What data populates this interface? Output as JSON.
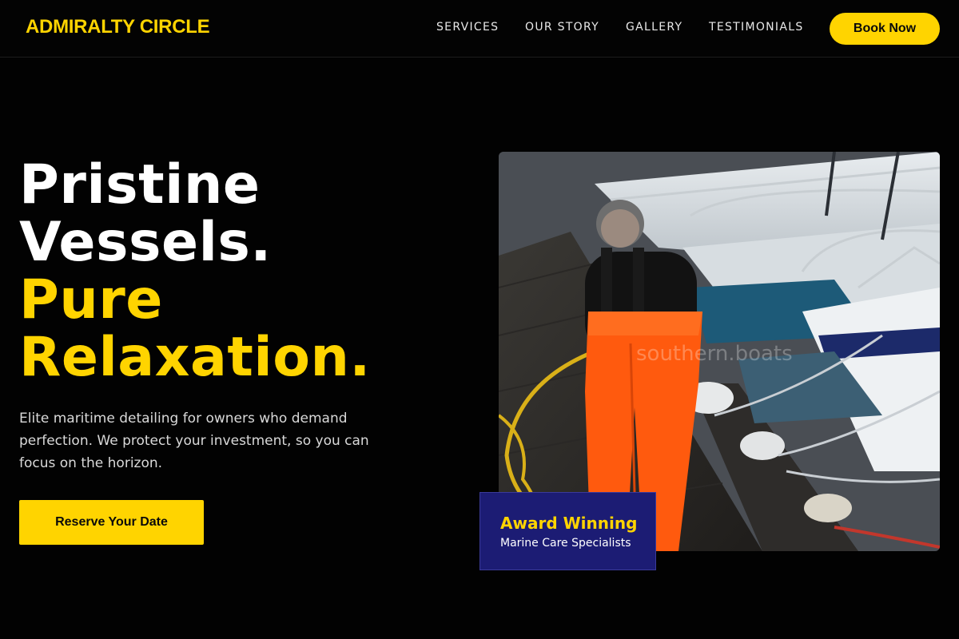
{
  "header": {
    "brand": "ADMIRALTY CIRCLE",
    "nav": [
      {
        "label": "SERVICES"
      },
      {
        "label": "OUR STORY"
      },
      {
        "label": "GALLERY"
      },
      {
        "label": "TESTIMONIALS"
      }
    ],
    "book_label": "Book Now"
  },
  "hero": {
    "headline_line1": "Pristine",
    "headline_line2": "Vessels.",
    "headline_line3": "Pure",
    "headline_line4": "Relaxation.",
    "description": "Elite maritime detailing for owners who demand perfection. We protect your investment, so you can focus on the horizon.",
    "cta_label": "Reserve Your Date",
    "photo_watermark": "southern.boats",
    "badge_title": "Award Winning",
    "badge_subtitle": "Marine Care Specialists"
  },
  "colors": {
    "accent": "#ffd400",
    "background": "#020202",
    "badge_bg": "#1c1c74"
  },
  "icons": {
    "photo": "marina-worker-photo"
  }
}
